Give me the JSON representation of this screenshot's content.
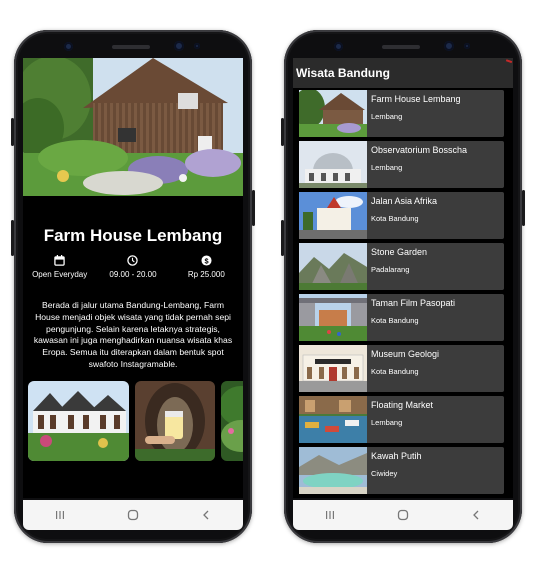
{
  "detail": {
    "title": "Farm House Lembang",
    "info": [
      {
        "icon": "calendar-icon",
        "text": "Open Everyday"
      },
      {
        "icon": "clock-icon",
        "text": "09.00 - 20.00"
      },
      {
        "icon": "dollar-icon",
        "text": "Rp 25.000"
      }
    ],
    "description": "Berada di jalur utama Bandung-Lembang, Farm House menjadi objek wisata yang tidak pernah sepi pengunjung. Selain karena letaknya strategis, kawasan ini juga menghadirkan nuansa wisata khas Eropa. Semua itu diterapkan dalam bentuk spot swafoto Instagramable."
  },
  "list": {
    "title": "Wisata Bandung",
    "items": [
      {
        "name": "Farm House Lembang",
        "location": "Lembang"
      },
      {
        "name": "Observatorium Bosscha",
        "location": "Lembang"
      },
      {
        "name": "Jalan Asia Afrika",
        "location": "Kota Bandung"
      },
      {
        "name": "Stone Garden",
        "location": "Padalarang"
      },
      {
        "name": "Taman Film Pasopati",
        "location": "Kota Bandung"
      },
      {
        "name": "Museum Geologi",
        "location": "Kota Bandung"
      },
      {
        "name": "Floating Market",
        "location": "Lembang"
      },
      {
        "name": "Kawah Putih",
        "location": "Ciwidey"
      }
    ]
  },
  "nav": {
    "icons": [
      "recent-apps-icon",
      "home-icon",
      "back-icon"
    ]
  },
  "colors": {
    "appbar": "#2b2b2b",
    "list_item": "#3c3c3c",
    "screen_bg": "#000000",
    "navbar": "#f5f5f5"
  }
}
